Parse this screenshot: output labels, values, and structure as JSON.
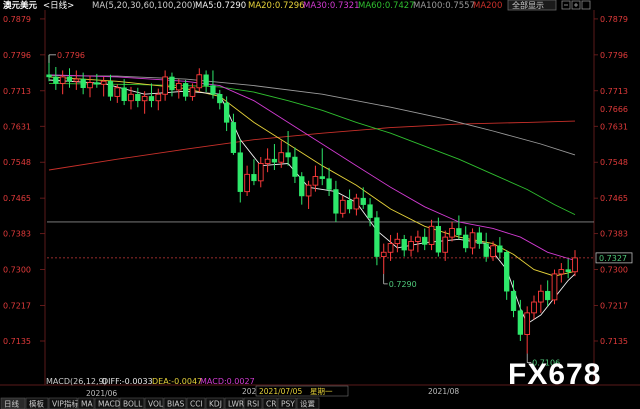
{
  "header": {
    "instrument": "澳元美元",
    "period": "<日线>",
    "ma_params": "MA(5,20,30,60,100,200)",
    "ma5": "MA5:0.7290",
    "ma20": "MA20:0.7296",
    "ma30": "MA30:0.7321",
    "ma60": "MA60:0.7427",
    "ma100": "MA100:0.7557",
    "ma200": "MA200",
    "button": "全部显示"
  },
  "colors": {
    "up": "#ff3b3b",
    "down": "#2ee86b",
    "ma5": "#f2f2f2",
    "ma20": "#e6d23a",
    "ma30": "#d23bd2",
    "ma60": "#2fbf2f",
    "ma100": "#9a9a9a",
    "ma200": "#c8302a"
  },
  "chart_data": {
    "type": "candlestick",
    "y_ticks": [
      "0.7879",
      "0.7796",
      "0.7713",
      "0.7631",
      "0.7548",
      "0.7465",
      "0.7383",
      "0.7300",
      "0.7217",
      "0.7135"
    ],
    "y_ticks_extra": [
      "0.7666"
    ],
    "ylim": [
      0.7068,
      0.7895
    ],
    "x_labels": [
      "2021/06",
      "2021/08"
    ],
    "high_label": "0.7796",
    "mid_low_label": "0.7290",
    "low_label": "0.7106",
    "current_price": "0.7327",
    "reference_line": 0.741,
    "candles": [
      {
        "o": 0.775,
        "h": 0.7796,
        "l": 0.7735,
        "c": 0.7745
      },
      {
        "o": 0.7745,
        "h": 0.7768,
        "l": 0.7715,
        "c": 0.773
      },
      {
        "o": 0.773,
        "h": 0.776,
        "l": 0.7705,
        "c": 0.7745
      },
      {
        "o": 0.7745,
        "h": 0.7765,
        "l": 0.772,
        "c": 0.7735
      },
      {
        "o": 0.7735,
        "h": 0.776,
        "l": 0.7715,
        "c": 0.774
      },
      {
        "o": 0.774,
        "h": 0.7755,
        "l": 0.7705,
        "c": 0.772
      },
      {
        "o": 0.772,
        "h": 0.7748,
        "l": 0.7698,
        "c": 0.7732
      },
      {
        "o": 0.7732,
        "h": 0.7752,
        "l": 0.772,
        "c": 0.7728
      },
      {
        "o": 0.7728,
        "h": 0.7745,
        "l": 0.77,
        "c": 0.7735
      },
      {
        "o": 0.7735,
        "h": 0.775,
        "l": 0.769,
        "c": 0.77
      },
      {
        "o": 0.77,
        "h": 0.7728,
        "l": 0.7685,
        "c": 0.772
      },
      {
        "o": 0.772,
        "h": 0.774,
        "l": 0.768,
        "c": 0.769
      },
      {
        "o": 0.769,
        "h": 0.7722,
        "l": 0.767,
        "c": 0.7705
      },
      {
        "o": 0.7705,
        "h": 0.772,
        "l": 0.7675,
        "c": 0.769
      },
      {
        "o": 0.769,
        "h": 0.7712,
        "l": 0.766,
        "c": 0.77
      },
      {
        "o": 0.77,
        "h": 0.773,
        "l": 0.7675,
        "c": 0.769
      },
      {
        "o": 0.769,
        "h": 0.7718,
        "l": 0.7668,
        "c": 0.7705
      },
      {
        "o": 0.7705,
        "h": 0.776,
        "l": 0.769,
        "c": 0.7745
      },
      {
        "o": 0.7745,
        "h": 0.7755,
        "l": 0.77,
        "c": 0.7715
      },
      {
        "o": 0.7715,
        "h": 0.774,
        "l": 0.7695,
        "c": 0.773
      },
      {
        "o": 0.773,
        "h": 0.7738,
        "l": 0.769,
        "c": 0.77
      },
      {
        "o": 0.77,
        "h": 0.773,
        "l": 0.769,
        "c": 0.772
      },
      {
        "o": 0.772,
        "h": 0.7765,
        "l": 0.771,
        "c": 0.775
      },
      {
        "o": 0.775,
        "h": 0.776,
        "l": 0.771,
        "c": 0.7725
      },
      {
        "o": 0.7725,
        "h": 0.776,
        "l": 0.7695,
        "c": 0.7705
      },
      {
        "o": 0.7705,
        "h": 0.7715,
        "l": 0.767,
        "c": 0.7685
      },
      {
        "o": 0.7685,
        "h": 0.77,
        "l": 0.762,
        "c": 0.764
      },
      {
        "o": 0.764,
        "h": 0.766,
        "l": 0.7565,
        "c": 0.757
      },
      {
        "o": 0.757,
        "h": 0.76,
        "l": 0.7455,
        "c": 0.748
      },
      {
        "o": 0.748,
        "h": 0.754,
        "l": 0.747,
        "c": 0.752
      },
      {
        "o": 0.752,
        "h": 0.7555,
        "l": 0.7495,
        "c": 0.7505
      },
      {
        "o": 0.7505,
        "h": 0.756,
        "l": 0.749,
        "c": 0.7545
      },
      {
        "o": 0.7545,
        "h": 0.758,
        "l": 0.7525,
        "c": 0.7555
      },
      {
        "o": 0.7555,
        "h": 0.759,
        "l": 0.753,
        "c": 0.7548
      },
      {
        "o": 0.7548,
        "h": 0.7598,
        "l": 0.7535,
        "c": 0.757
      },
      {
        "o": 0.757,
        "h": 0.762,
        "l": 0.754,
        "c": 0.756
      },
      {
        "o": 0.756,
        "h": 0.7582,
        "l": 0.75,
        "c": 0.7515
      },
      {
        "o": 0.7515,
        "h": 0.7525,
        "l": 0.745,
        "c": 0.747
      },
      {
        "o": 0.747,
        "h": 0.7505,
        "l": 0.744,
        "c": 0.7495
      },
      {
        "o": 0.7495,
        "h": 0.754,
        "l": 0.748,
        "c": 0.7515
      },
      {
        "o": 0.7515,
        "h": 0.758,
        "l": 0.7495,
        "c": 0.751
      },
      {
        "o": 0.751,
        "h": 0.7535,
        "l": 0.747,
        "c": 0.7485
      },
      {
        "o": 0.7485,
        "h": 0.7505,
        "l": 0.741,
        "c": 0.743
      },
      {
        "o": 0.743,
        "h": 0.747,
        "l": 0.742,
        "c": 0.746
      },
      {
        "o": 0.746,
        "h": 0.7485,
        "l": 0.743,
        "c": 0.744
      },
      {
        "o": 0.744,
        "h": 0.7475,
        "l": 0.7425,
        "c": 0.7465
      },
      {
        "o": 0.7465,
        "h": 0.749,
        "l": 0.744,
        "c": 0.745
      },
      {
        "o": 0.745,
        "h": 0.7465,
        "l": 0.74,
        "c": 0.742
      },
      {
        "o": 0.742,
        "h": 0.7435,
        "l": 0.731,
        "c": 0.733
      },
      {
        "o": 0.733,
        "h": 0.736,
        "l": 0.729,
        "c": 0.734
      },
      {
        "o": 0.734,
        "h": 0.738,
        "l": 0.732,
        "c": 0.736
      },
      {
        "o": 0.736,
        "h": 0.7385,
        "l": 0.734,
        "c": 0.737
      },
      {
        "o": 0.737,
        "h": 0.738,
        "l": 0.733,
        "c": 0.7345
      },
      {
        "o": 0.7345,
        "h": 0.7378,
        "l": 0.733,
        "c": 0.7365
      },
      {
        "o": 0.7365,
        "h": 0.739,
        "l": 0.734,
        "c": 0.7375
      },
      {
        "o": 0.7375,
        "h": 0.7395,
        "l": 0.7345,
        "c": 0.7358
      },
      {
        "o": 0.7358,
        "h": 0.7415,
        "l": 0.7345,
        "c": 0.74
      },
      {
        "o": 0.74,
        "h": 0.742,
        "l": 0.733,
        "c": 0.734
      },
      {
        "o": 0.734,
        "h": 0.739,
        "l": 0.732,
        "c": 0.7375
      },
      {
        "o": 0.7375,
        "h": 0.741,
        "l": 0.7365,
        "c": 0.7395
      },
      {
        "o": 0.7395,
        "h": 0.7425,
        "l": 0.737,
        "c": 0.738
      },
      {
        "o": 0.738,
        "h": 0.74,
        "l": 0.734,
        "c": 0.735
      },
      {
        "o": 0.735,
        "h": 0.7395,
        "l": 0.7335,
        "c": 0.7385
      },
      {
        "o": 0.7385,
        "h": 0.7398,
        "l": 0.7348,
        "c": 0.736
      },
      {
        "o": 0.736,
        "h": 0.7385,
        "l": 0.7318,
        "c": 0.733
      },
      {
        "o": 0.733,
        "h": 0.7365,
        "l": 0.732,
        "c": 0.7355
      },
      {
        "o": 0.7355,
        "h": 0.7375,
        "l": 0.7325,
        "c": 0.734
      },
      {
        "o": 0.734,
        "h": 0.7345,
        "l": 0.723,
        "c": 0.725
      },
      {
        "o": 0.725,
        "h": 0.7275,
        "l": 0.719,
        "c": 0.7205
      },
      {
        "o": 0.7205,
        "h": 0.723,
        "l": 0.7135,
        "c": 0.715
      },
      {
        "o": 0.715,
        "h": 0.7215,
        "l": 0.7106,
        "c": 0.72
      },
      {
        "o": 0.72,
        "h": 0.724,
        "l": 0.7185,
        "c": 0.7225
      },
      {
        "o": 0.7225,
        "h": 0.7265,
        "l": 0.72,
        "c": 0.725
      },
      {
        "o": 0.725,
        "h": 0.7275,
        "l": 0.7215,
        "c": 0.723
      },
      {
        "o": 0.723,
        "h": 0.73,
        "l": 0.722,
        "c": 0.729
      },
      {
        "o": 0.729,
        "h": 0.7315,
        "l": 0.727,
        "c": 0.73
      },
      {
        "o": 0.73,
        "h": 0.7325,
        "l": 0.728,
        "c": 0.7295
      },
      {
        "o": 0.7295,
        "h": 0.7345,
        "l": 0.7285,
        "c": 0.7327
      }
    ],
    "ma_lines": {
      "ma5": [
        [
          0,
          0.7738
        ],
        [
          8,
          0.773
        ],
        [
          14,
          0.7705
        ],
        [
          20,
          0.7712
        ],
        [
          25,
          0.7705
        ],
        [
          28,
          0.76
        ],
        [
          31,
          0.754
        ],
        [
          35,
          0.7545
        ],
        [
          38,
          0.749
        ],
        [
          42,
          0.748
        ],
        [
          45,
          0.7455
        ],
        [
          48,
          0.739
        ],
        [
          51,
          0.735
        ],
        [
          55,
          0.7362
        ],
        [
          60,
          0.737
        ],
        [
          64,
          0.736
        ],
        [
          67,
          0.73
        ],
        [
          69,
          0.721
        ],
        [
          70,
          0.7175
        ],
        [
          72,
          0.7195
        ],
        [
          74,
          0.7235
        ],
        [
          76,
          0.7275
        ],
        [
          77,
          0.729
        ]
      ],
      "ma20": [
        [
          0,
          0.7745
        ],
        [
          10,
          0.7735
        ],
        [
          20,
          0.7718
        ],
        [
          25,
          0.77
        ],
        [
          30,
          0.764
        ],
        [
          35,
          0.759
        ],
        [
          40,
          0.754
        ],
        [
          45,
          0.7495
        ],
        [
          50,
          0.744
        ],
        [
          55,
          0.74
        ],
        [
          60,
          0.7375
        ],
        [
          65,
          0.736
        ],
        [
          68,
          0.7335
        ],
        [
          71,
          0.73
        ],
        [
          74,
          0.7285
        ],
        [
          77,
          0.7296
        ]
      ],
      "ma30": [
        [
          0,
          0.775
        ],
        [
          10,
          0.7745
        ],
        [
          20,
          0.7735
        ],
        [
          25,
          0.7725
        ],
        [
          30,
          0.769
        ],
        [
          35,
          0.764
        ],
        [
          40,
          0.759
        ],
        [
          45,
          0.754
        ],
        [
          50,
          0.749
        ],
        [
          55,
          0.7445
        ],
        [
          60,
          0.741
        ],
        [
          65,
          0.7395
        ],
        [
          69,
          0.7375
        ],
        [
          73,
          0.734
        ],
        [
          77,
          0.7321
        ]
      ],
      "ma60": [
        [
          0,
          0.773
        ],
        [
          10,
          0.7728
        ],
        [
          20,
          0.7725
        ],
        [
          25,
          0.7722
        ],
        [
          30,
          0.771
        ],
        [
          35,
          0.769
        ],
        [
          40,
          0.7668
        ],
        [
          45,
          0.764
        ],
        [
          50,
          0.7615
        ],
        [
          55,
          0.7585
        ],
        [
          60,
          0.7555
        ],
        [
          65,
          0.752
        ],
        [
          70,
          0.7485
        ],
        [
          74,
          0.745
        ],
        [
          77,
          0.7427
        ]
      ],
      "ma100": [
        [
          0,
          0.7748
        ],
        [
          10,
          0.7747
        ],
        [
          20,
          0.774
        ],
        [
          30,
          0.7725
        ],
        [
          40,
          0.7705
        ],
        [
          50,
          0.7675
        ],
        [
          58,
          0.7648
        ],
        [
          65,
          0.762
        ],
        [
          72,
          0.759
        ],
        [
          77,
          0.7565
        ]
      ],
      "ma200": [
        [
          0,
          0.753
        ],
        [
          10,
          0.7555
        ],
        [
          20,
          0.7578
        ],
        [
          30,
          0.76
        ],
        [
          40,
          0.7615
        ],
        [
          50,
          0.7628
        ],
        [
          60,
          0.7636
        ],
        [
          70,
          0.764
        ],
        [
          77,
          0.7643
        ]
      ]
    },
    "overlay_text": "FX678"
  },
  "macd_row": {
    "label": "MACD(26,12,9)",
    "diff": "DIFF:-0.0033",
    "dea": "DEA:-0.0047",
    "macd": "MACD:0.0027"
  },
  "date_row": {
    "left_date": "202",
    "selected_date": "2021/07/05",
    "weekday": "星期一",
    "right_date": "2021/08"
  },
  "tabs": [
    "日线",
    "模板",
    "VIP指标",
    "MA",
    "MACD",
    "BOLL",
    "VOL",
    "BIAS",
    "CCI",
    "KDJ",
    "LWR",
    "RSI",
    "CR",
    "PSY",
    "设置"
  ]
}
